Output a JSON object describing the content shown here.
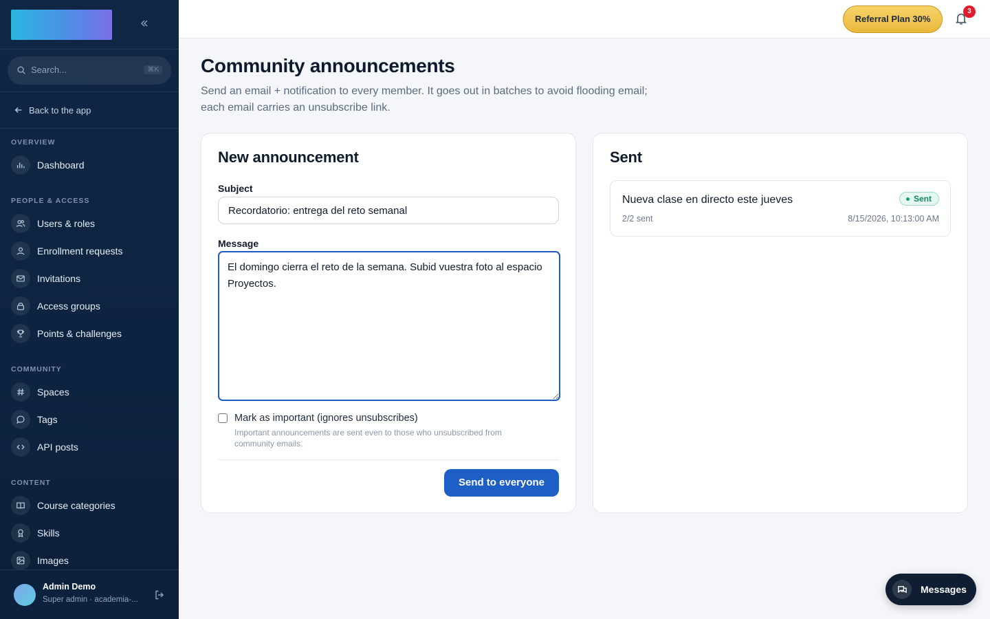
{
  "sidebar": {
    "search_placeholder": "Search...",
    "search_shortcut": "⌘K",
    "back_label": "Back to the app",
    "sections": [
      {
        "title": "OVERVIEW",
        "items": [
          {
            "label": "Dashboard",
            "icon": "bar-chart-icon"
          }
        ]
      },
      {
        "title": "PEOPLE & ACCESS",
        "items": [
          {
            "label": "Users & roles",
            "icon": "users-icon"
          },
          {
            "label": "Enrollment requests",
            "icon": "user-icon"
          },
          {
            "label": "Invitations",
            "icon": "mail-icon"
          },
          {
            "label": "Access groups",
            "icon": "lock-icon"
          },
          {
            "label": "Points & challenges",
            "icon": "trophy-icon"
          }
        ]
      },
      {
        "title": "COMMUNITY",
        "items": [
          {
            "label": "Spaces",
            "icon": "hash-icon"
          },
          {
            "label": "Tags",
            "icon": "chat-bubble-icon"
          },
          {
            "label": "API posts",
            "icon": "code-icon"
          }
        ]
      },
      {
        "title": "CONTENT",
        "items": [
          {
            "label": "Course categories",
            "icon": "book-icon"
          },
          {
            "label": "Skills",
            "icon": "award-icon"
          },
          {
            "label": "Images",
            "icon": "image-icon"
          }
        ]
      }
    ],
    "user": {
      "name": "Admin Demo",
      "role": "Super admin · academia-..."
    }
  },
  "topbar": {
    "referral_label": "Referral Plan 30%",
    "notification_count": "3"
  },
  "main": {
    "title": "Community announcements",
    "description": "Send an email + notification to every member. It goes out in batches to avoid flooding email; each email carries an unsubscribe link.",
    "new_card": {
      "title": "New announcement",
      "subject_label": "Subject",
      "subject_value": "Recordatorio: entrega del reto semanal",
      "message_label": "Message",
      "message_value": "El domingo cierra el reto de la semana. Subid vuestra foto al espacio Proyectos.",
      "important_label": "Mark as important (ignores unsubscribes)",
      "important_checked": false,
      "important_help": "Important announcements are sent even to those who unsubscribed from community emails.",
      "send_label": "Send to everyone"
    },
    "sent_card": {
      "title": "Sent",
      "items": [
        {
          "subject": "Nueva clase en directo este jueves",
          "status": "Sent",
          "count": "2/2 sent",
          "date": "8/15/2026, 10:13:00 AM"
        }
      ]
    }
  },
  "messages_label": "Messages",
  "colors": {
    "sidebar_bg": "#0f2744",
    "primary": "#1e5fc6",
    "referral": "#e9b93a",
    "badge": "#e11d2b",
    "sent_status": "#0f8a5f"
  }
}
